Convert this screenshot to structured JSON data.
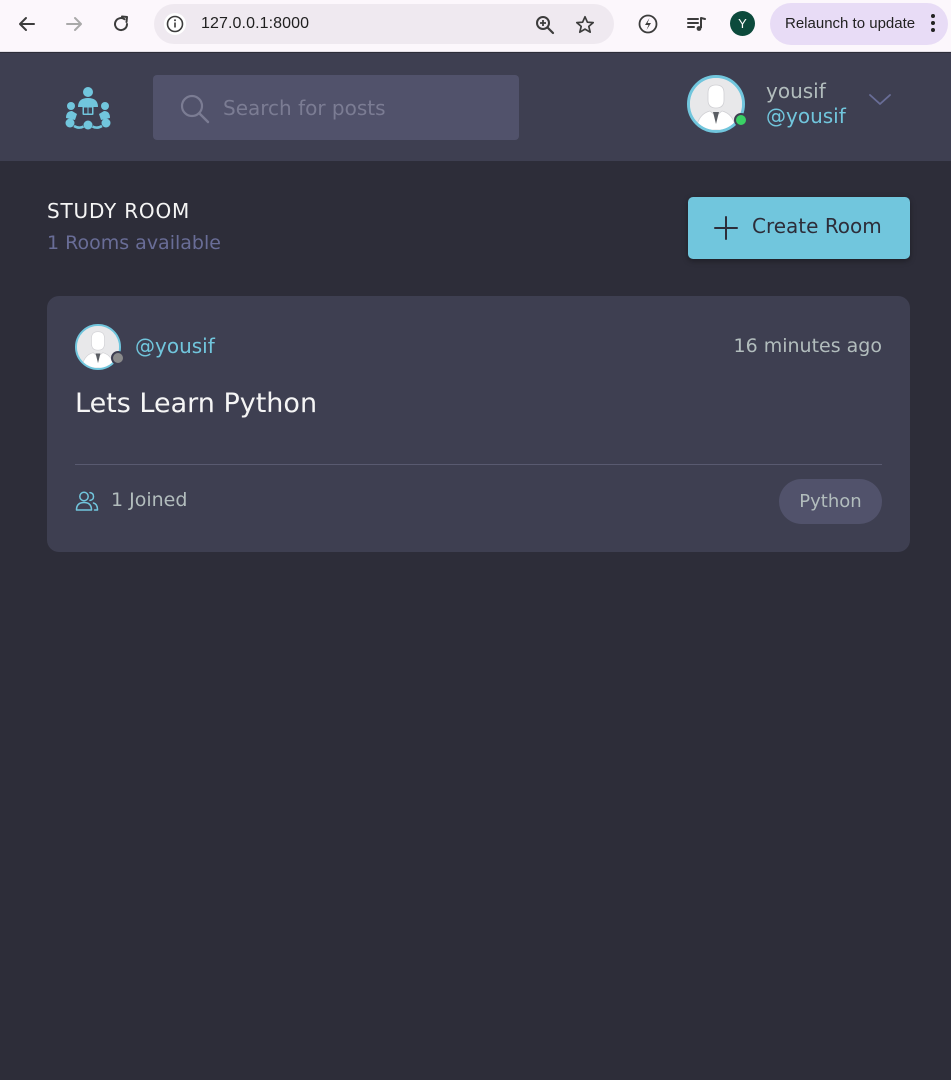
{
  "browser": {
    "url": "127.0.0.1:8000",
    "profile_initial": "Y",
    "relaunch_label": "Relaunch to update"
  },
  "header": {
    "search_placeholder": "Search for posts",
    "user": {
      "name": "yousif",
      "handle": "@yousif",
      "status": "online"
    }
  },
  "main": {
    "title": "STUDY ROOM",
    "subtitle": "1 Rooms available",
    "create_button_label": "Create Room"
  },
  "rooms": [
    {
      "host_handle": "@yousif",
      "time": "16 minutes ago",
      "title": "Lets Learn Python",
      "joined": "1 Joined",
      "topic": "Python"
    }
  ],
  "colors": {
    "accent": "#71c6dd",
    "background": "#2d2d39",
    "header_bg": "#3e3f51",
    "card_bg": "#3e3f51",
    "input_bg": "#51526b",
    "online": "#3ad165",
    "offline": "#8a8a8a",
    "subtle_text": "#696d97"
  }
}
